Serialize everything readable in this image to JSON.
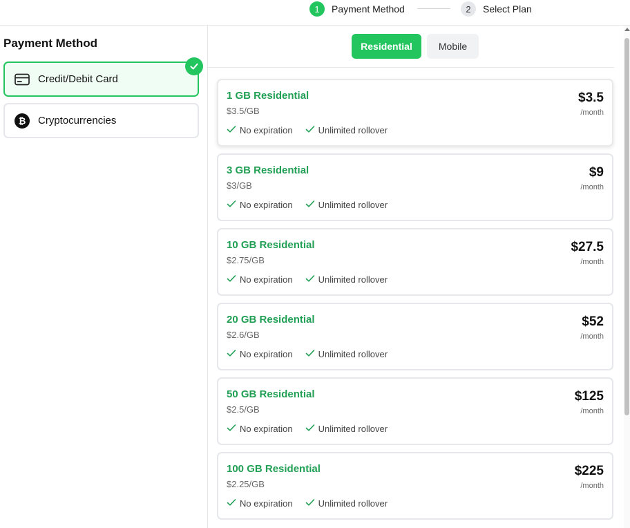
{
  "stepper": {
    "steps": [
      {
        "num": "1",
        "label": "Payment Method"
      },
      {
        "num": "2",
        "label": "Select Plan"
      }
    ]
  },
  "payment": {
    "title": "Payment Method",
    "methods": [
      {
        "label": "Credit/Debit Card",
        "icon": "credit-card-icon"
      },
      {
        "label": "Cryptocurrencies",
        "icon": "bitcoin-icon"
      }
    ]
  },
  "tabs": {
    "residential": "Residential",
    "mobile": "Mobile"
  },
  "colors": {
    "accent": "#22c55e",
    "plan_name": "#22a055"
  },
  "plans": [
    {
      "name": "1 GB Residential",
      "unit": "$3.5/GB",
      "price": "$3.5",
      "per": "/month",
      "feat1": "No expiration",
      "feat2": "Unlimited rollover"
    },
    {
      "name": "3 GB Residential",
      "unit": "$3/GB",
      "price": "$9",
      "per": "/month",
      "feat1": "No expiration",
      "feat2": "Unlimited rollover"
    },
    {
      "name": "10 GB Residential",
      "unit": "$2.75/GB",
      "price": "$27.5",
      "per": "/month",
      "feat1": "No expiration",
      "feat2": "Unlimited rollover"
    },
    {
      "name": "20 GB Residential",
      "unit": "$2.6/GB",
      "price": "$52",
      "per": "/month",
      "feat1": "No expiration",
      "feat2": "Unlimited rollover"
    },
    {
      "name": "50 GB Residential",
      "unit": "$2.5/GB",
      "price": "$125",
      "per": "/month",
      "feat1": "No expiration",
      "feat2": "Unlimited rollover"
    },
    {
      "name": "100 GB Residential",
      "unit": "$2.25/GB",
      "price": "$225",
      "per": "/month",
      "feat1": "No expiration",
      "feat2": "Unlimited rollover"
    }
  ]
}
